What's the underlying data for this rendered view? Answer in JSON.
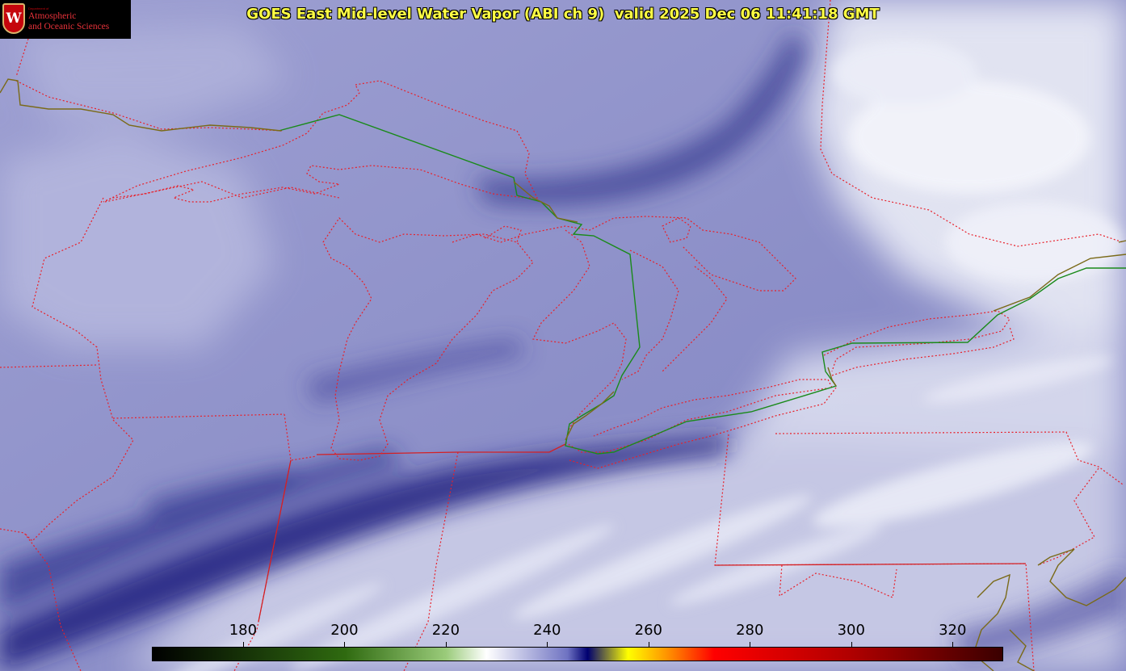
{
  "title": "GOES East Mid-level Water Vapor (ABI ch 9)  valid 2025 Dec 06 11:41:18 GMT",
  "logo": {
    "crest_letter": "W",
    "department_line": "Department of",
    "line1": "Atmospheric",
    "line2": "and Oceanic Sciences"
  },
  "colorbar": {
    "min": 162,
    "max": 330,
    "ticks": [
      "180",
      "200",
      "220",
      "240",
      "260",
      "280",
      "300",
      "320"
    ],
    "tick_values": [
      180,
      200,
      220,
      240,
      260,
      280,
      300,
      320
    ],
    "stops": [
      {
        "value": 162,
        "color": "#000000"
      },
      {
        "value": 200,
        "color": "#2f6a10"
      },
      {
        "value": 220,
        "color": "#9acb7a"
      },
      {
        "value": 228,
        "color": "#ffffff"
      },
      {
        "value": 244,
        "color": "#6f73c2"
      },
      {
        "value": 248,
        "color": "#000070"
      },
      {
        "value": 256,
        "color": "#ffff00"
      },
      {
        "value": 265,
        "color": "#ff8000"
      },
      {
        "value": 273,
        "color": "#ff0000"
      },
      {
        "value": 300,
        "color": "#b00000"
      },
      {
        "value": 330,
        "color": "#3a0000"
      }
    ]
  },
  "colors": {
    "state_borders": "#e8202a",
    "international_border": "#1a8a1a",
    "coastline": "#8a7a20",
    "title_text": "#ffff44"
  }
}
